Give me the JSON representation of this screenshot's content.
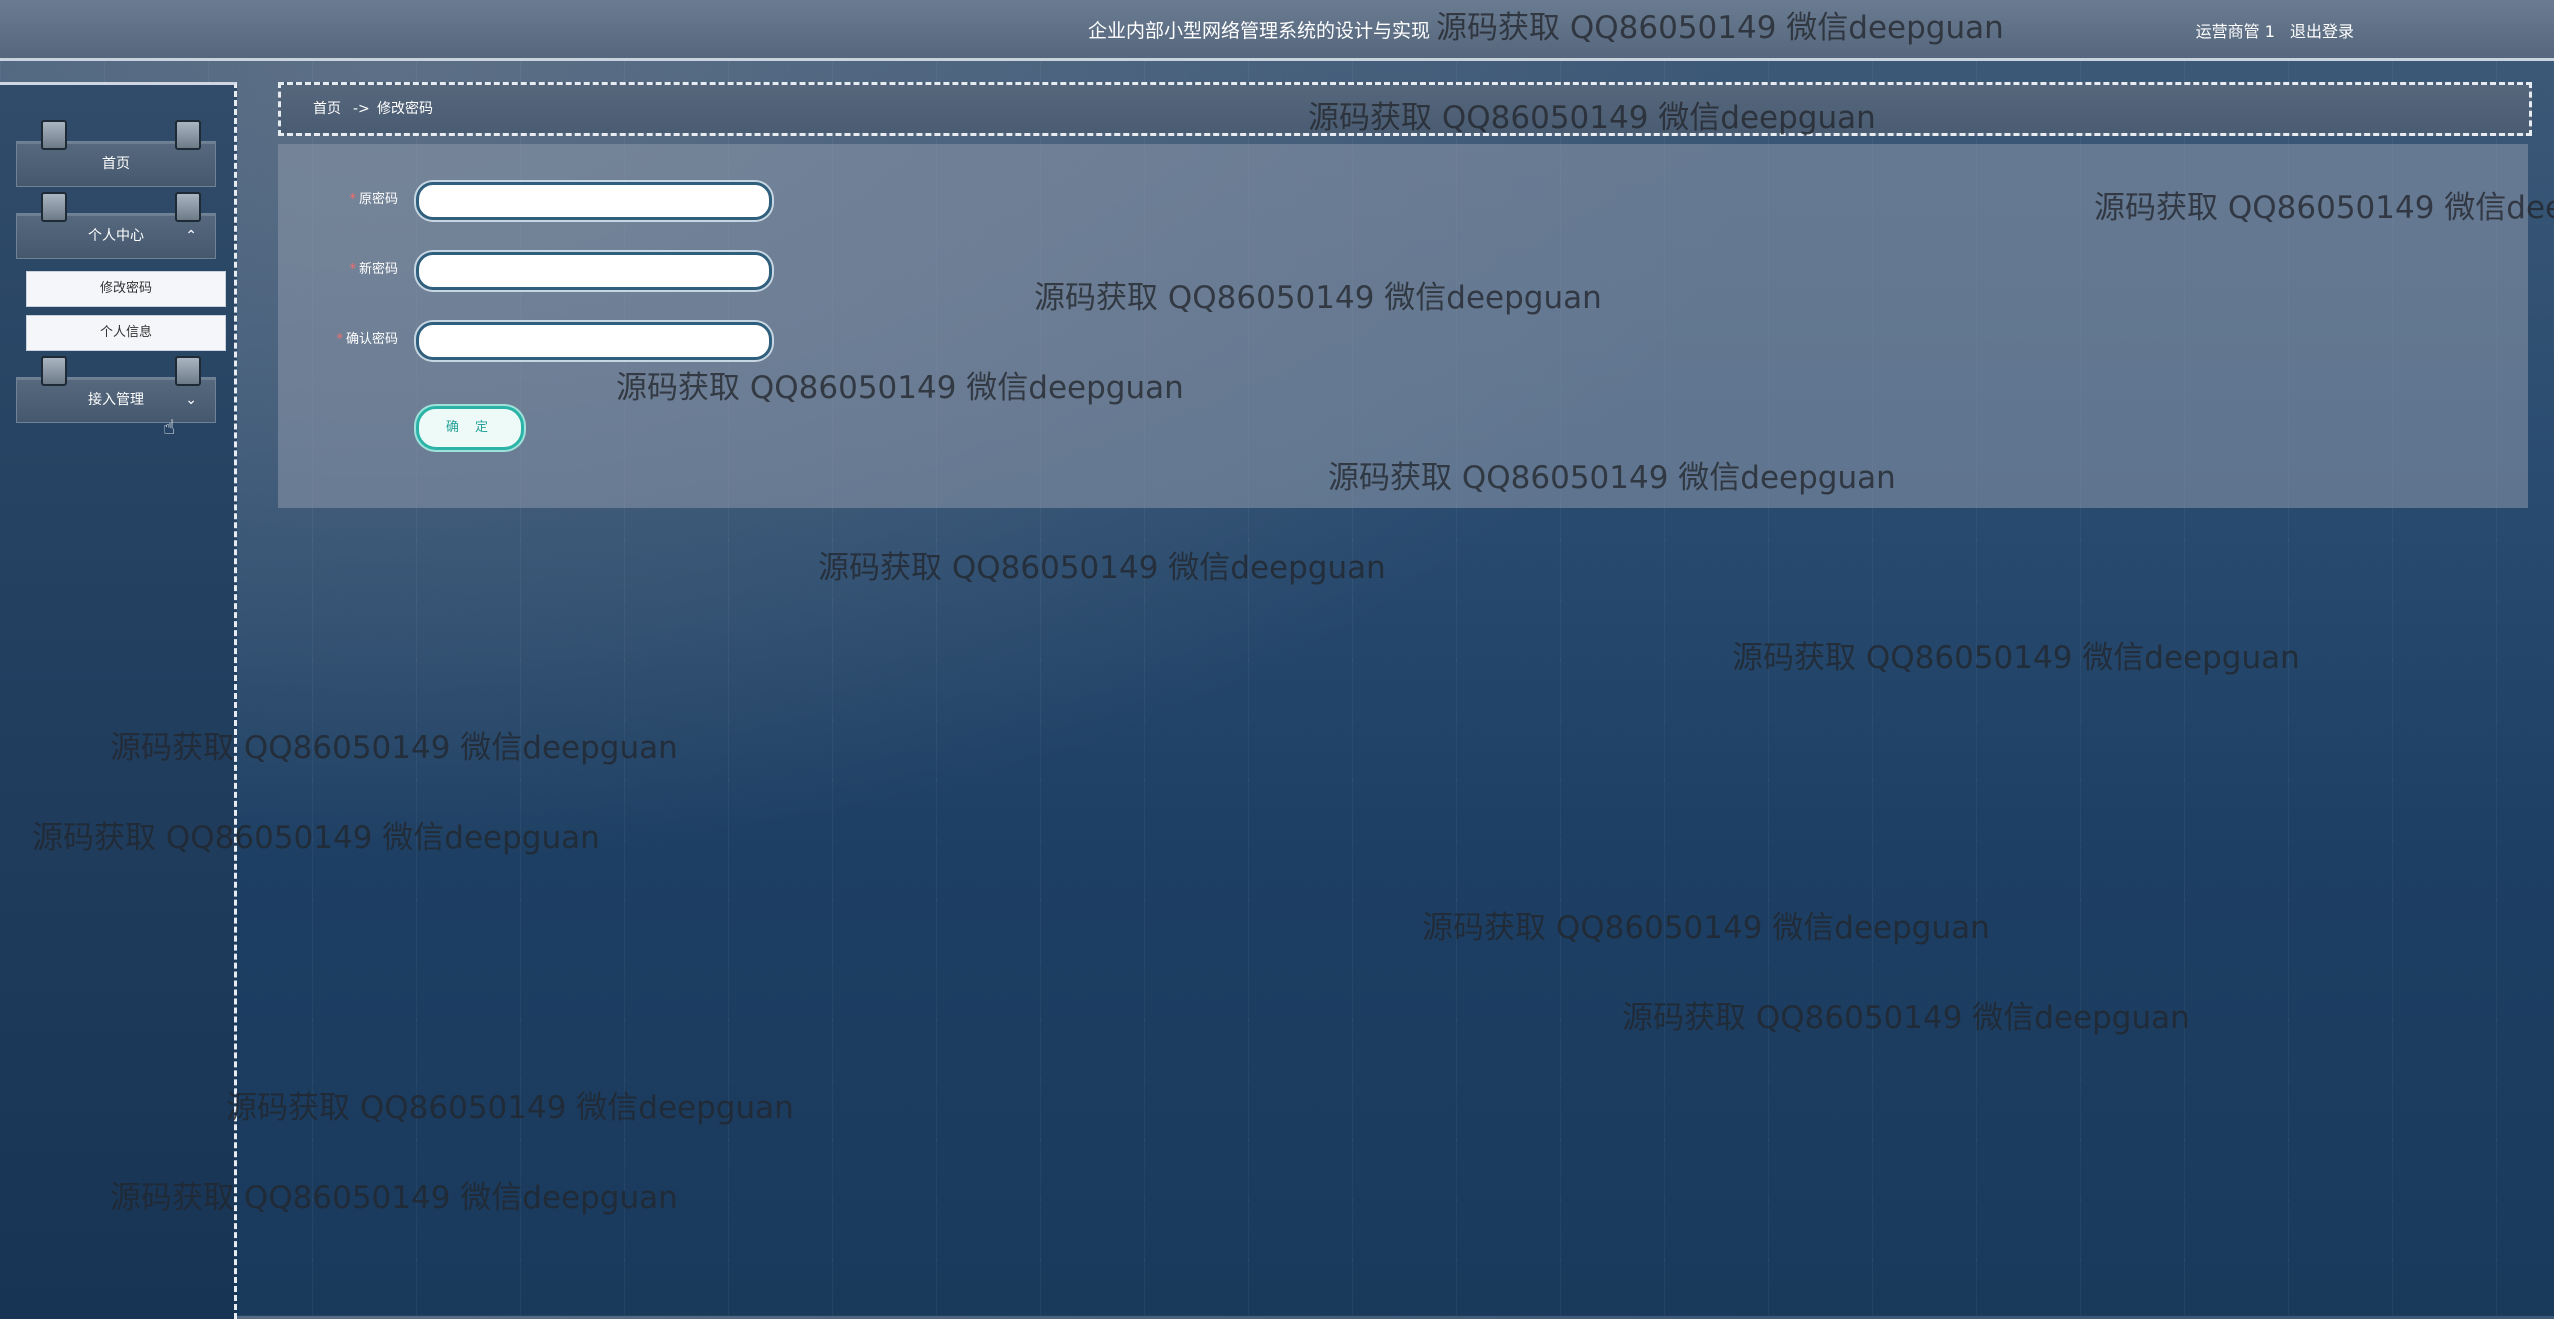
{
  "header": {
    "title": "企业内部小型网络管理系统的设计与实现",
    "user": "运营商管 1",
    "logout": "退出登录"
  },
  "sidebar": {
    "home": "首页",
    "personal_center": "个人中心",
    "submenu": [
      "修改密码",
      "个人信息"
    ],
    "access_mgmt": "接入管理"
  },
  "breadcrumb": {
    "home": "首页",
    "separator": "->",
    "current": "修改密码"
  },
  "form": {
    "old_password_label": "原密码",
    "new_password_label": "新密码",
    "confirm_password_label": "确认密码",
    "required_mark": "*",
    "submit_label": "确 定"
  },
  "watermark": "源码获取 QQ86050149 微信deepguan",
  "colors": {
    "accent": "#2cb3a8",
    "required": "#f56c6c"
  },
  "icons": {
    "expand": "chevron-up-icon",
    "collapse": "chevron-down-icon",
    "pointer": "hand-pointer-icon"
  }
}
